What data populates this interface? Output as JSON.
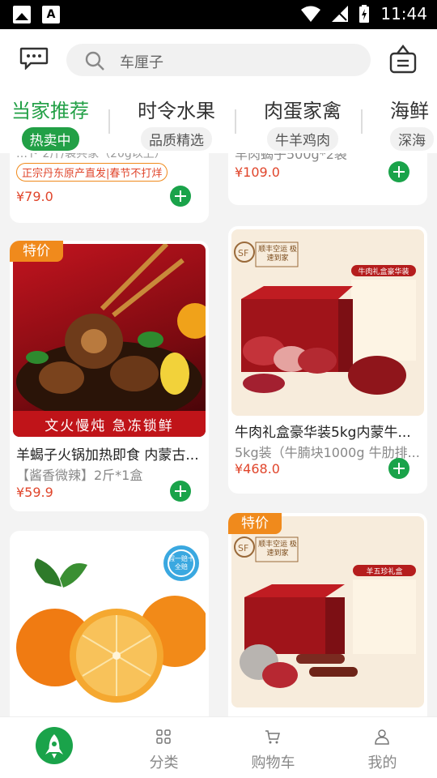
{
  "status_bar": {
    "time": "11:44"
  },
  "search": {
    "placeholder": "车厘子"
  },
  "categories": [
    {
      "title": "当家推荐",
      "subtitle": "热卖中"
    },
    {
      "title": "时令水果",
      "subtitle": "品质精选"
    },
    {
      "title": "肉蛋家禽",
      "subtitle": "牛羊鸡肉"
    },
    {
      "title": "海鲜",
      "subtitle": "深海"
    }
  ],
  "products": [
    {
      "tag": "正宗丹东原产直发|春节不打烊",
      "price": "¥79.0",
      "partial_title": "…ド 2斤/袋共家（20g以上）"
    },
    {
      "subtitle": "羊肉蝎子500g*2袋",
      "price": "¥109.0"
    },
    {
      "badge": "特价",
      "title": "羊蝎子火锅加热即食 内蒙古...",
      "subtitle": "【酱香微辣】2斤*1盒",
      "price": "¥59.9",
      "banner": "文火慢炖 急冻锁鲜"
    },
    {
      "title": "牛肉礼盒豪华装5kg内蒙牛...",
      "subtitle": "5kg装（牛腩块1000g 牛肋排...",
      "price": "¥468.0",
      "sf": "顺丰空运 极速到家",
      "box_title": "牛肉礼盒豪华装"
    },
    {
      "seal": "假一赔十 全赔"
    },
    {
      "badge": "特价",
      "sf": "顺丰空运 极速到家",
      "box_title": "羊五珍礼盒"
    }
  ],
  "tabbar": {
    "items": [
      {
        "label": ""
      },
      {
        "label": "分类"
      },
      {
        "label": "购物车"
      },
      {
        "label": "我的"
      }
    ]
  },
  "colors": {
    "accent": "#1aa34a",
    "price": "#e0452b",
    "badge": "#f08a1c"
  }
}
